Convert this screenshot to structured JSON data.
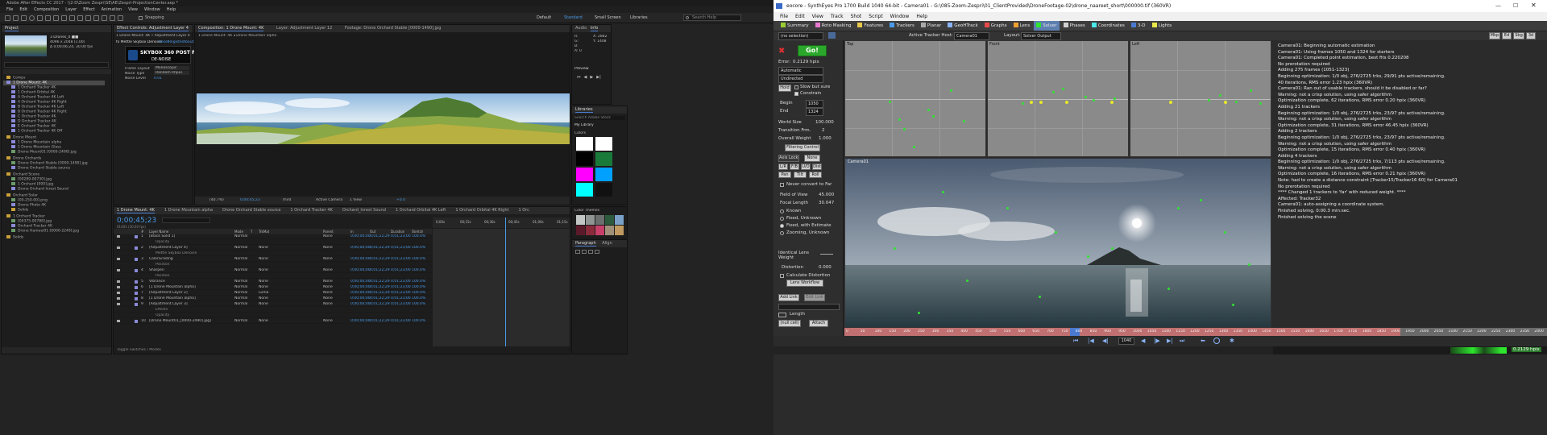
{
  "after_effects": {
    "title": "Adobe After Effects CC 2017 - \\\\2-D\\Zoom Zespri\\SE\\AE\\Zespri-ProjectionCenter.aep *",
    "menu": [
      "File",
      "Edit",
      "Composition",
      "Layer",
      "Effect",
      "Animation",
      "View",
      "Window",
      "Help"
    ],
    "workspace": [
      "Default",
      "Standard",
      "Small Screen",
      "Libraries"
    ],
    "search_placeholder": "Search Help",
    "toolbar_label": "Snapping",
    "project_panel": {
      "tab": "Project",
      "thumb_info": [
        "3 Drones_0 ■■",
        "4096 x 2048 (1.00)",
        "Δ 0;00;06;24, 30.00 fps"
      ],
      "items": [
        "Comps",
        "1 Drone Mount: 4K",
        "1 Orchard Tracker 4K",
        "1 Orchard Orbital 4K",
        "A Orchard Tracker 4K Left",
        "A Orchard Tracker 4K Right",
        "B Orchard Tracker 4K Left",
        "B Orchard Tracker 4K Right",
        "C Orchard Tracker 4K",
        "D Orchard Tracker 4K",
        "E Orchard Tracker 4K",
        "1 Orchard Tracker 4K Off",
        "Drone Mount",
        "1 Drone Mountain alpha",
        "1 Drone Mountain Glass",
        "Drone Mount01 [0000-2490].jpg",
        "Drone Orchards",
        "Drone Orchard Stable [0000-1490].jpg",
        "Drone Orchard Stable source",
        "Orchard Scene",
        "[00289-00730].jpg",
        "1 Orchard [000].jpg",
        "Drone Orchard Inrest Sound",
        "Orchard Solar",
        "[00-250-00].png",
        "Drone Photo 4K",
        "Solids",
        "1 Orchard Tracker",
        "[00375-00788].jpg",
        "Orchard Tracker 4K",
        "Drone Hameei01 [0000-2249].jpg",
        "Solids"
      ]
    },
    "effect_controls": {
      "tab": "Effect Controls: Adjustment Layer 4",
      "sub": "1 Drone Mount: 4K • Adjustment Layer 4",
      "effect": "fx  Mettle Skybox Denoise",
      "reset": "Reset",
      "register": "Register",
      "about": "About...",
      "logo_line1": "SKYBOX 360 POST FX",
      "logo_line2": "DE-NOISE",
      "props": [
        [
          "Frame Layout",
          "Monoscopic"
        ],
        [
          "Noise Type",
          "Random Impul."
        ],
        [
          "Noise Level",
          "0.01"
        ]
      ]
    },
    "composition": {
      "tab": "Composition: 1 Drone Mount: 4K",
      "tabs2": "Layer: Adjustment Layer 12",
      "tabs3": "Footage: Drone Orchard Stable [0000-1490].jpg",
      "sub": "1 Drone Mount: 4K  ◂  Drone Mountain alpha",
      "zoom": "(40.7%)",
      "timecode": "0;00;45;23",
      "resolution": "Third",
      "camera": "Active Camera",
      "view": "1 View",
      "offset": "+0.0"
    },
    "info": {
      "tabs": [
        "Audio",
        "Info",
        "Preview"
      ],
      "values": [
        "R:",
        "G:",
        "B:",
        "A: 0"
      ],
      "xy": [
        "X: 2882",
        "Y: 1408"
      ]
    },
    "libraries": {
      "tab": "Libraries",
      "search": "Search Adobe Stock",
      "library": "My Library",
      "colors_label": "Colors",
      "themes_label": "Color Themes",
      "colors": [
        "#ffffff",
        "#ffffff",
        "#000000",
        "#1a7a3a",
        "#ff00ff",
        "#00a0ff",
        "#00ffff",
        "#111111"
      ],
      "themes": [
        "#c2c6c4",
        "#8f9593",
        "#6b6f6d",
        "#2c5a3c",
        "#7aa0c8",
        "#5a1a2a",
        "#8a2a3a",
        "#c8406a",
        "#a0907a",
        "#c09a60"
      ]
    },
    "paragraph": {
      "tabs": [
        "Paragraph",
        "Align"
      ]
    },
    "timeline": {
      "tabs": [
        "1 Drone Mount: 4K",
        "1 Drone Mountain alpha",
        "Drone Orchard Stable source",
        "1 Orchard Tracker 4K",
        "Orchard_Inrest Sound",
        "1 Orchard Orbital 4K Left",
        "1 Orchard Orbital 4K Right",
        "1 Orc"
      ],
      "timecode": "0;00;45;23",
      "frames": "01403 (30.00 fps)",
      "columns": [
        "#",
        "Layer Name",
        "Mode",
        "T",
        "TrkMat",
        "Parent",
        "In",
        "Out",
        "Duration",
        "Stretch"
      ],
      "rows": [
        {
          "n": "1",
          "name": "[Black Solid 1]",
          "mode": "Normal",
          "trk": "",
          "parent": "None",
          "in": "0;00;00;00",
          "out": "0;01;22;29",
          "dur": "0;01;23;00",
          "st": "100.0%",
          "sub": false
        },
        {
          "n": "",
          "name": "Opacity",
          "mode": "",
          "trk": "",
          "parent": "",
          "in": "",
          "out": "",
          "dur": "",
          "st": "",
          "sub": true
        },
        {
          "n": "2",
          "name": "[Adjustment Layer 4]",
          "mode": "Normal",
          "trk": "None",
          "parent": "None",
          "in": "0;00;00;00",
          "out": "0;01;22;29",
          "dur": "0;01;23;00",
          "st": "100.0%",
          "sub": false
        },
        {
          "n": "",
          "name": "Mettle Skybox Denoise",
          "mode": "",
          "trk": "",
          "parent": "",
          "in": "",
          "out": "",
          "dur": "",
          "st": "",
          "sub": true
        },
        {
          "n": "3",
          "name": "ColorGrading",
          "mode": "Normal",
          "trk": "None",
          "parent": "None",
          "in": "0;00;00;00",
          "out": "0;01;22;29",
          "dur": "0;01;23;00",
          "st": "100.0%",
          "sub": false
        },
        {
          "n": "",
          "name": "Position",
          "mode": "",
          "trk": "",
          "parent": "",
          "in": "",
          "out": "",
          "dur": "",
          "st": "",
          "sub": true
        },
        {
          "n": "4",
          "name": "Sharpen",
          "mode": "Normal",
          "trk": "None",
          "parent": "None",
          "in": "0;00;00;00",
          "out": "0;01;22;29",
          "dur": "0;01;23;00",
          "st": "100.0%",
          "sub": false
        },
        {
          "n": "",
          "name": "Position",
          "mode": "",
          "trk": "",
          "parent": "",
          "in": "",
          "out": "",
          "dur": "",
          "st": "",
          "sub": true
        },
        {
          "n": "5",
          "name": "Vibrance",
          "mode": "Normal",
          "trk": "None",
          "parent": "None",
          "in": "0;00;00;00",
          "out": "0;01;22;29",
          "dur": "0;01;23;00",
          "st": "100.0%",
          "sub": false
        },
        {
          "n": "6",
          "name": "[1 Drone Mountain alpha]",
          "mode": "Normal",
          "trk": "None",
          "parent": "None",
          "in": "0;00;00;00",
          "out": "0;01;22;29",
          "dur": "0;01;23;00",
          "st": "100.0%",
          "sub": false
        },
        {
          "n": "7",
          "name": "[Adjustment Layer 2]",
          "mode": "Normal",
          "trk": "Luma",
          "parent": "None",
          "in": "0;00;00;00",
          "out": "0;01;22;29",
          "dur": "0;01;23;00",
          "st": "100.0%",
          "sub": false
        },
        {
          "n": "8",
          "name": "[1 Drone Mountain alpha]",
          "mode": "Normal",
          "trk": "None",
          "parent": "None",
          "in": "0;00;00;00",
          "out": "0;01;22;29",
          "dur": "0;01;23;00",
          "st": "100.0%",
          "sub": false
        },
        {
          "n": "9",
          "name": "[Adjustment Layer 3]",
          "mode": "Normal",
          "trk": "None",
          "parent": "None",
          "in": "0;00;00;00",
          "out": "0;01;22;29",
          "dur": "0;01;23;00",
          "st": "100.0%",
          "sub": false
        },
        {
          "n": "",
          "name": "Effects",
          "mode": "",
          "trk": "",
          "parent": "",
          "in": "",
          "out": "",
          "dur": "",
          "st": "",
          "sub": true
        },
        {
          "n": "",
          "name": "Opacity",
          "mode": "",
          "trk": "",
          "parent": "",
          "in": "",
          "out": "",
          "dur": "",
          "st": "",
          "sub": true
        },
        {
          "n": "10",
          "name": "[Drone Mount01_[0000-2490].jpg]",
          "mode": "Normal",
          "trk": "None",
          "parent": "None",
          "in": "0;00;00;00",
          "out": "0;01;22;29",
          "dur": "0;01;23;00",
          "st": "100.0%",
          "sub": false
        }
      ],
      "ruler": [
        "0;00s",
        "00;15s",
        "00;30s",
        "00;45s",
        "01;00s",
        "01;15s"
      ],
      "footer": "Toggle Switches / Modes"
    }
  },
  "synth_eyes": {
    "title": "eocore - SynthEyes Pro 1700 Build 1040 64-bit - Camera01 - G:\\085-Zoom-Zespri\\01_ClientProvided\\DroneFootage-02\\drone_naareet_short\\000000.tif (360VR)",
    "menu": [
      "File",
      "Edit",
      "View",
      "Track",
      "Shot",
      "Script",
      "Window",
      "Help"
    ],
    "rooms": [
      "Summary",
      "Roto Masking",
      "Features",
      "Trackers",
      "Planar",
      "GeoHTrack",
      "Graphs",
      "Lens",
      "Solver",
      "Phases",
      "Coordinates",
      "3-D",
      "Lights"
    ],
    "active_room": "Solver",
    "topbar": {
      "selection": "(no selection)",
      "active_tracker_host_label": "Active Tracker Host:",
      "host": "Camera01",
      "layout_label": "Layout:",
      "layout": "Solver Output",
      "right_buttons": [
        "Mkp",
        "Ed",
        "Sbg",
        "3d"
      ]
    },
    "solver_panel": {
      "go": "Go!",
      "error_label": "Error:",
      "error_value": "0.2129 hpix",
      "mode": "Automatic",
      "direction": "Undirected",
      "hold": "Hold",
      "slow_but_sure": "Slow but sure",
      "constrain": "Constrain",
      "begin_label": "Begin",
      "begin_value": "1050",
      "end_label": "End",
      "end_value": "1324",
      "world_size_label": "World Size",
      "world_size": "100.000",
      "transition_label": "Transition Frm.",
      "transition": "2",
      "overall_weight_label": "Overall Weight",
      "overall_weight": "1.000",
      "filtering_control": "Filtering Control",
      "axis_locks": "Axis Locks",
      "none": "None",
      "locks": [
        "L/R",
        "F/B",
        "U/D",
        "Dist",
        "Pan",
        "Tilt",
        "Roll"
      ],
      "never_convert": "Never convert to Far",
      "fov_label": "Field of View",
      "fov": "45.000",
      "focal_label": "Focal Length",
      "focal": "30.047",
      "lens_options": [
        "Known",
        "Fixed, Unknown",
        "Fixed, with Estimate",
        "Zooming, Unknown"
      ],
      "identical_label": "Identical Lens Weight",
      "distortion_label": "Distortion",
      "distortion": "0.000",
      "calc_distortion": "Calculate Distortion",
      "lens_workflow": "Lens Workflow",
      "add_link": "Add Link",
      "edit_link": "Edit Link",
      "length_label": "Length",
      "null_cell": "(null cell)",
      "attach": "Attach"
    },
    "viewports": {
      "top": "Top",
      "front": "Front",
      "left": "Left",
      "camera": "Camera01"
    },
    "log": [
      "Camera01: Beginning automatic estimation",
      "Camera01: Using frames 1050 and 1324 for starters",
      "Camera01: Completed point estimation, best fits 0.220208",
      "No prerotation required",
      "Adding 275 frames (1051-1323)",
      "Beginning optimization: 1/0 obj, 276/2725 trks, 29/91 pts active/remaining.",
      "40 iterations, RMS error 1.23 hpix (360VR)",
      "Camera01: Ran out of usable trackers, should it be disabled or far?",
      "Warning: not a crisp solution, using safer algorithm",
      "Optimization complete, 62 iterations, RMS error 0.20 hpix (360VR)",
      "Adding 21 trackers",
      "Beginning optimization: 1/0 obj, 276/2725 trks, 23/97 pts active/remaining.",
      "Warning: not a crisp solution, using safer algorithm",
      "Optimization complete, 31 iterations, RMS error 46.45 hpix (360VR)",
      "Adding 2 trackers",
      "Beginning optimization: 1/0 obj, 276/2725 trks, 23/97 pts active/remaining.",
      "Warning: not a crisp solution, using safer algorithm",
      "Optimization complete, 15 iterations, RMS error 0.40 hpix (360VR)",
      "Adding 4 trackers",
      "Beginning optimization: 1/0 obj, 276/2725 trks, 7/113 pts active/remaining.",
      "Warning: not a crisp solution, using safer algorithm",
      "Optimization complete, 16 iterations, RMS error 0.21 hpix (360VR)",
      "Note: had to create a distance constraint [Tracker15/Tracker16 60] for Camera01",
      "No prerotation required",
      "**** Changed 1 trackers to 'far' with reduced weight. ****",
      "Affected: Tracker32",
      "Camera01: auto-assigning a coordinate system.",
      "Finished solving, 0:00.3 min:sec.",
      "Finished solving the scene"
    ],
    "timeline": {
      "frame": "1040",
      "ticks": [
        "0",
        "50",
        "100",
        "150",
        "200",
        "250",
        "300",
        "350",
        "400",
        "450",
        "500",
        "550",
        "600",
        "650",
        "700",
        "750",
        "800",
        "850",
        "900",
        "950",
        "1000",
        "1050",
        "1100",
        "1150",
        "1200",
        "1250",
        "1300",
        "1350",
        "1400",
        "1450",
        "1500",
        "1550",
        "1600",
        "1650",
        "1700",
        "1750",
        "1800",
        "1850",
        "1900",
        "1950",
        "2000",
        "2050",
        "2100",
        "2150",
        "2200",
        "2250",
        "2300",
        "2350",
        "2400"
      ]
    },
    "status": "0.2129 hpix"
  }
}
